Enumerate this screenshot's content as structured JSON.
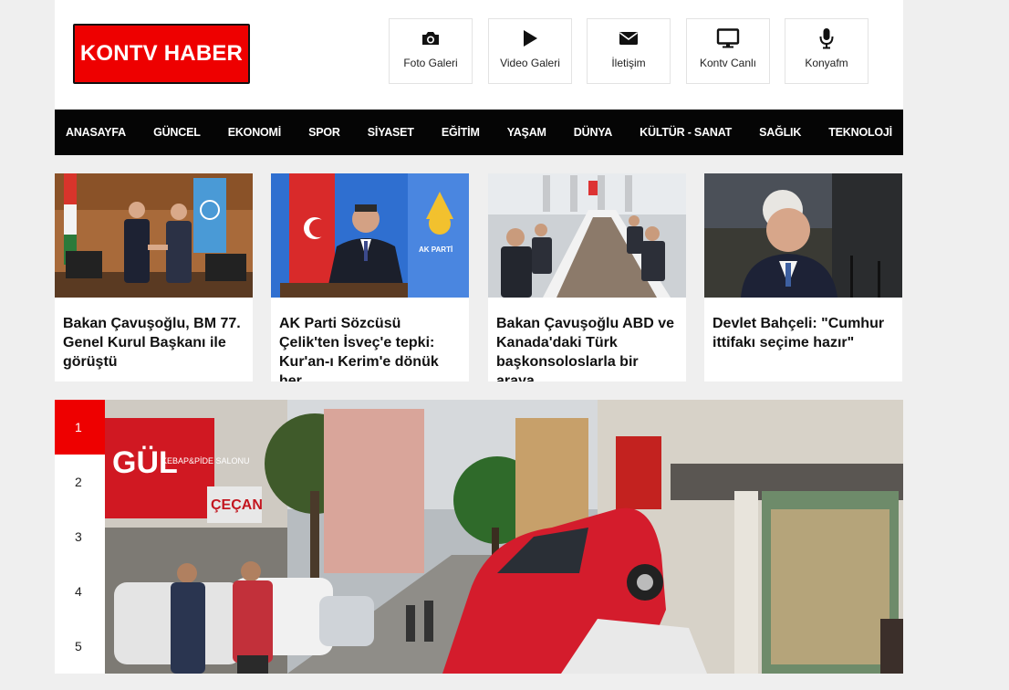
{
  "site": {
    "logo": "KONTV HABER"
  },
  "header": {
    "quick_links": [
      {
        "label": "Foto Galeri",
        "icon": "camera-icon"
      },
      {
        "label": "Video Galeri",
        "icon": "play-icon"
      },
      {
        "label": "İletişim",
        "icon": "envelope-icon"
      },
      {
        "label": "Kontv Canlı",
        "icon": "monitor-icon"
      },
      {
        "label": "Konyafm",
        "icon": "microphone-icon"
      }
    ]
  },
  "nav": {
    "items": [
      "ANASAYFA",
      "GÜNCEL",
      "EKONOMİ",
      "SPOR",
      "SİYASET",
      "EĞİTİM",
      "YAŞAM",
      "DÜNYA",
      "KÜLTÜR - SANAT",
      "SAĞLIK",
      "TEKNOLOJİ"
    ]
  },
  "cards": [
    {
      "title": "Bakan Çavuşoğlu, BM 77. Genel Kurul Başkanı ile görüştü"
    },
    {
      "title": "AK Parti Sözcüsü Çelik'ten İsveç'e tepki: Kur'an-ı Kerim'e dönük her"
    },
    {
      "title": "Bakan Çavuşoğlu ABD ve Kanada'daki Türk başkonsoloslarla bir araya"
    },
    {
      "title": "Devlet Bahçeli: \"Cumhur ittifakı seçime hazır\""
    }
  ],
  "slider": {
    "tabs": [
      "1",
      "2",
      "3",
      "4",
      "5"
    ],
    "active_tab": "1",
    "slide_signs": {
      "sign1": "GÜL",
      "sign2": "KEBAP&PİDE SALONU",
      "sign3": "ÇEÇAN"
    }
  },
  "card_images": {
    "ak_parti_logo_text": "AK PARTİ"
  },
  "colors": {
    "brand_red": "#ee0000",
    "nav_bg": "#050505",
    "page_bg": "#efefef"
  }
}
